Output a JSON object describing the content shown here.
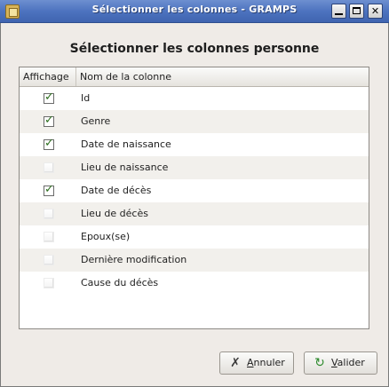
{
  "window": {
    "title": "Sélectionner les colonnes - GRAMPS"
  },
  "dialog": {
    "heading": "Sélectionner les colonnes personne"
  },
  "table": {
    "headers": {
      "show": "Affichage",
      "name": "Nom de la colonne"
    },
    "rows": [
      {
        "label": "Id",
        "checked": true
      },
      {
        "label": "Genre",
        "checked": true
      },
      {
        "label": "Date de naissance",
        "checked": true
      },
      {
        "label": "Lieu de naissance",
        "checked": false
      },
      {
        "label": "Date de décès",
        "checked": true
      },
      {
        "label": "Lieu de décès",
        "checked": false
      },
      {
        "label": "Epoux(se)",
        "checked": false
      },
      {
        "label": "Dernière modification",
        "checked": false
      },
      {
        "label": "Cause du décès",
        "checked": false
      }
    ]
  },
  "buttons": {
    "cancel": {
      "mnemonic": "A",
      "rest": "nnuler"
    },
    "ok": {
      "mnemonic": "V",
      "rest": "alider"
    }
  },
  "colors": {
    "titlebar": "#4d73bf",
    "check": "#2c6e1e"
  }
}
